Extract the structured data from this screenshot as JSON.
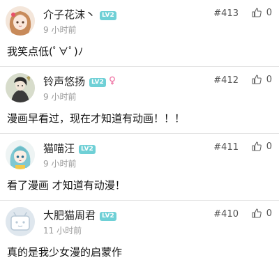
{
  "comments": [
    {
      "username": "介子花沫丶",
      "level": "LV2",
      "time": "9 小时前",
      "floor": "#413",
      "likes": "0",
      "content": "我笑点低(ﾟ∀ﾟ)ﾉ"
    },
    {
      "username": "铃声悠扬",
      "level": "LV2",
      "time": "9 小时前",
      "floor": "#412",
      "likes": "0",
      "content": "漫画早看过，现在才知道有动画！！！"
    },
    {
      "username": "猫喵汪",
      "level": "LV2",
      "time": "9 小时前",
      "floor": "#411",
      "likes": "0",
      "content": "看了漫画 才知道有动漫！"
    },
    {
      "username": "大肥猫周君",
      "level": "LV2",
      "time": "11 小时前",
      "floor": "#410",
      "likes": "0",
      "content": "真的是我少女漫的启蒙作"
    }
  ],
  "colors": {
    "level_badge": "#6fd0d6",
    "gender_female": "#f07aa8",
    "divider": "#e3e3e3",
    "timestamp": "#9a9a9a"
  }
}
